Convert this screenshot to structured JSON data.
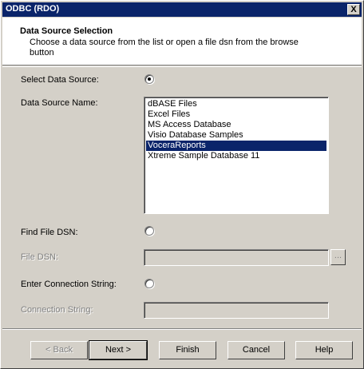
{
  "window": {
    "title": "ODBC (RDO)",
    "close_label": "X"
  },
  "header": {
    "title": "Data Source Selection",
    "description": "Choose a data source from the list or open a file dsn from the browse button"
  },
  "form": {
    "select_data_source_label": "Select Data Source:",
    "data_source_name_label": "Data Source Name:",
    "data_sources": [
      "dBASE Files",
      "Excel Files",
      "MS Access Database",
      "Visio Database Samples",
      "VoceraReports",
      "Xtreme Sample Database 11"
    ],
    "selected_data_source": "VoceraReports",
    "find_file_dsn_label": "Find File DSN:",
    "file_dsn_label": "File DSN:",
    "file_dsn_value": "",
    "browse_label": "...",
    "enter_connection_string_label": "Enter Connection String:",
    "connection_string_label": "Connection String:",
    "connection_string_value": "",
    "selected_option": "Select Data Source"
  },
  "buttons": {
    "back": "< Back",
    "next": "Next >",
    "finish": "Finish",
    "cancel": "Cancel",
    "help": "Help"
  }
}
